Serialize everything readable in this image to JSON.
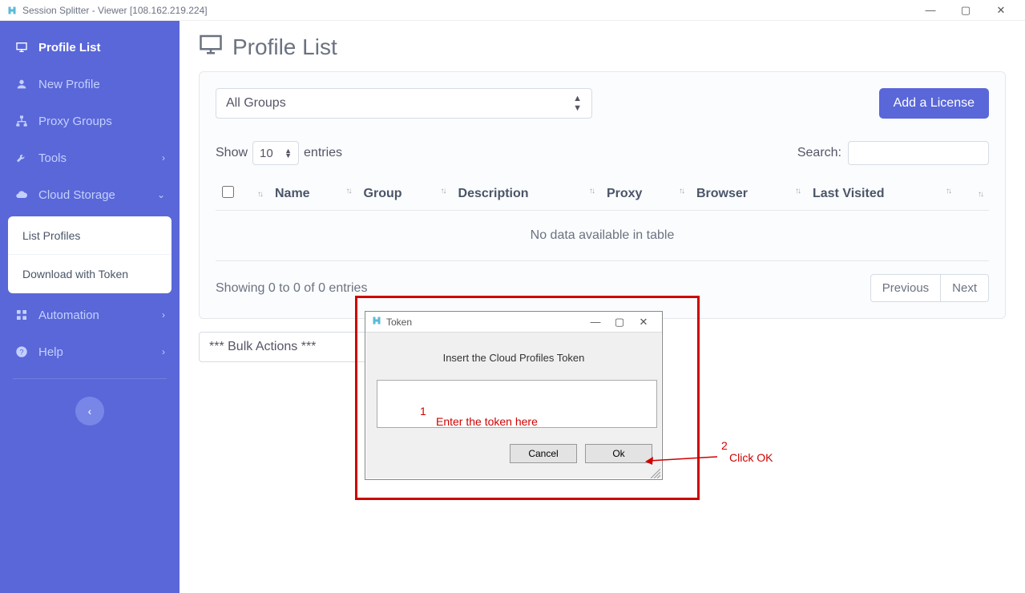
{
  "window": {
    "title": "Session Splitter - Viewer [108.162.219.224]"
  },
  "sidebar": {
    "items": [
      {
        "label": "Profile List",
        "icon": "monitor",
        "active": true
      },
      {
        "label": "New Profile",
        "icon": "user"
      },
      {
        "label": "Proxy Groups",
        "icon": "sitemap"
      },
      {
        "label": "Tools",
        "icon": "wrench",
        "chev": "›"
      },
      {
        "label": "Cloud Storage",
        "icon": "cloud",
        "chev": "⌄"
      }
    ],
    "cloudSub": [
      {
        "label": "List Profiles"
      },
      {
        "label": "Download with Token"
      }
    ],
    "lower": [
      {
        "label": "Automation",
        "icon": "grid",
        "chev": "›"
      },
      {
        "label": "Help",
        "icon": "question",
        "chev": "›"
      }
    ]
  },
  "page": {
    "title": "Profile List",
    "groupSelect": "All Groups",
    "licenseBtn": "Add a License",
    "showLabel": "Show",
    "entriesValue": "10",
    "entriesLabel": "entries",
    "searchLabel": "Search:",
    "columns": [
      "Name",
      "Group",
      "Description",
      "Proxy",
      "Browser",
      "Last Visited",
      ""
    ],
    "noData": "No data available in table",
    "footerInfo": "Showing 0 to 0 of 0 entries",
    "prev": "Previous",
    "next": "Next",
    "bulk": "*** Bulk Actions ***"
  },
  "dialog": {
    "title": "Token",
    "label": "Insert the Cloud Profiles Token",
    "cancel": "Cancel",
    "ok": "Ok"
  },
  "annotations": {
    "step1num": "1",
    "step1text": "Enter the token here",
    "step2num": "2",
    "step2text": "Click OK"
  }
}
